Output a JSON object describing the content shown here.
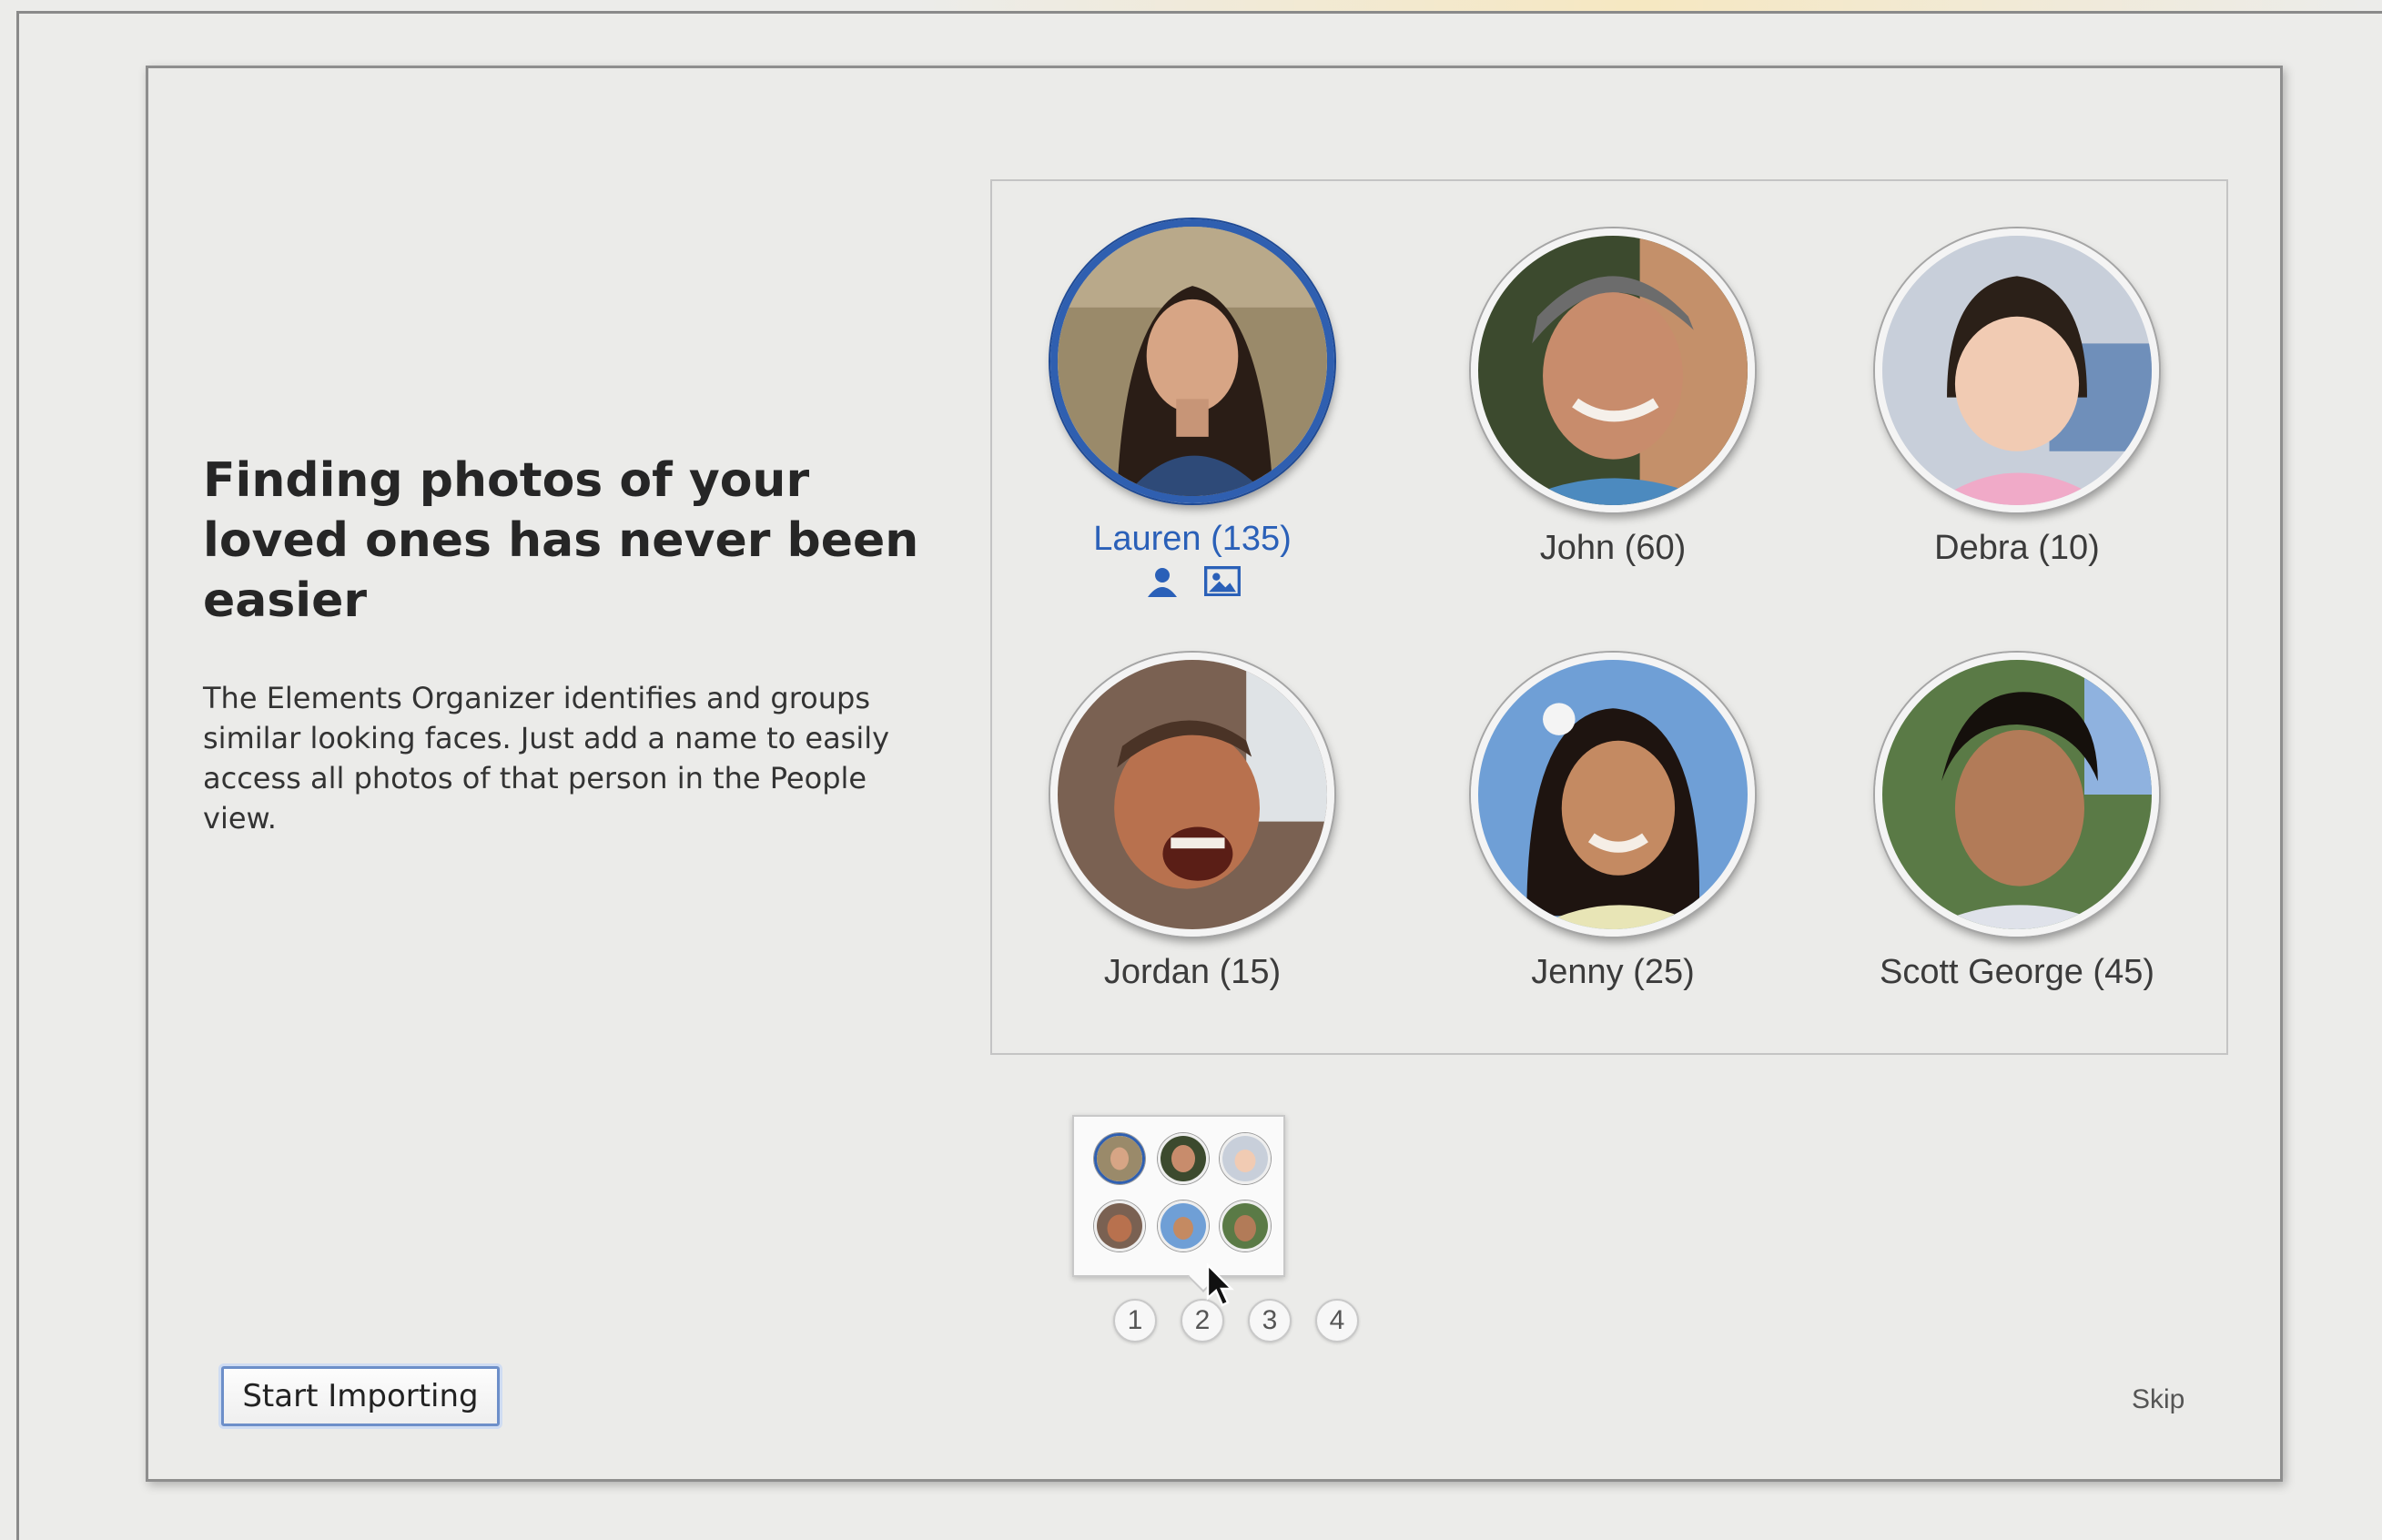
{
  "headline": "Finding photos of your loved ones has never been easier",
  "description": "The Elements Organizer identifies and groups similar looking faces. Just add a name to easily access all photos of that person in the People view.",
  "people": [
    {
      "label": "Lauren (135)",
      "selected": true
    },
    {
      "label": "John (60)",
      "selected": false
    },
    {
      "label": "Debra (10)",
      "selected": false
    },
    {
      "label": "Jordan (15)",
      "selected": false
    },
    {
      "label": "Jenny (25)",
      "selected": false
    },
    {
      "label": "Scott George (45)",
      "selected": false
    }
  ],
  "pager": {
    "pages": [
      "1",
      "2",
      "3",
      "4"
    ],
    "hovered": "2"
  },
  "actions": {
    "start_label": "Start Importing",
    "skip_label": "Skip"
  },
  "colors": {
    "accent": "#2f5fb0",
    "selected_text": "#2a60b8",
    "background": "#ebebe9"
  }
}
